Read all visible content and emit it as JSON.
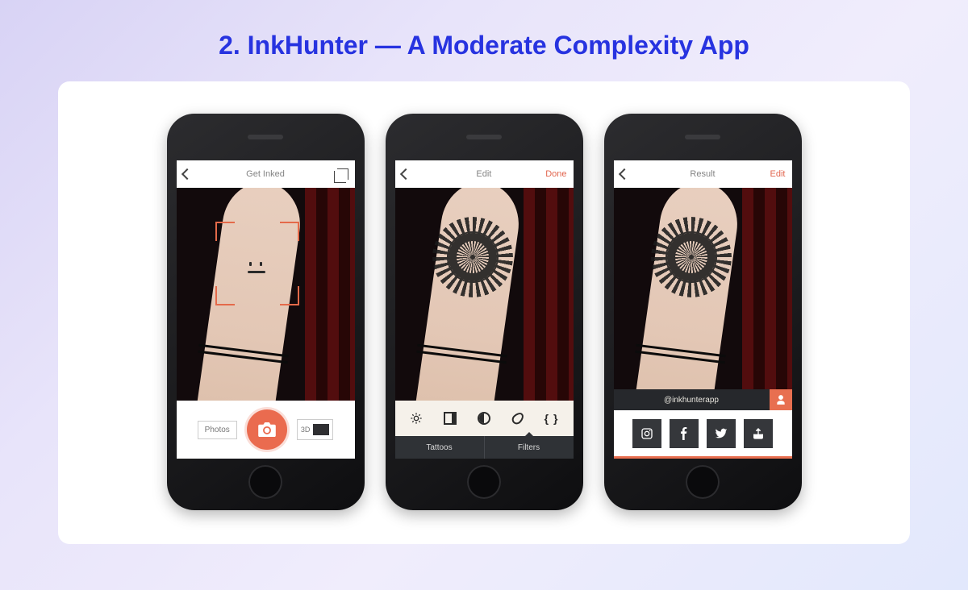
{
  "heading": "2. InkHunter — A Moderate Complexity App",
  "screens": {
    "s1": {
      "nav_title": "Get Inked",
      "photos_label": "Photos",
      "threed_label": "3D"
    },
    "s2": {
      "nav_title": "Edit",
      "nav_action": "Done",
      "tools": {
        "brightness": "brightness",
        "contrast": "contrast",
        "halftone": "halftone",
        "opacity": "opacity",
        "crop": "crop"
      },
      "tabs": {
        "tattoos": "Tattoos",
        "filters": "Filters"
      }
    },
    "s3": {
      "nav_title": "Result",
      "nav_action": "Edit",
      "watermark": "@inkhunterapp",
      "share": {
        "instagram": "instagram",
        "facebook": "facebook",
        "twitter": "twitter",
        "export": "export"
      }
    }
  },
  "icons": {
    "back": "back-arrow",
    "crop": "crop-icon",
    "camera": "camera-icon",
    "user": "user-icon"
  }
}
